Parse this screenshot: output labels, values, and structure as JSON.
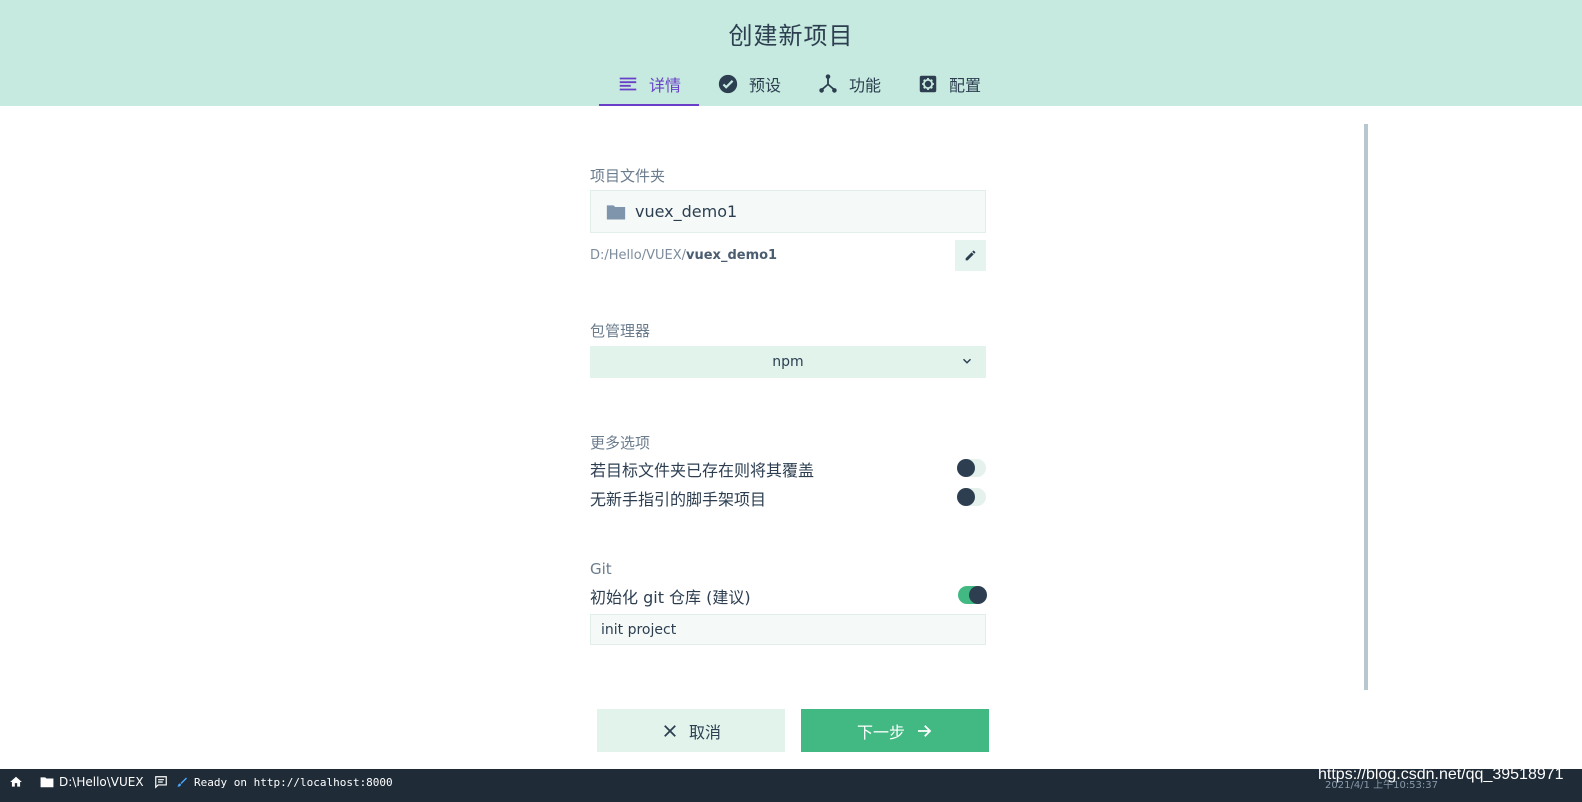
{
  "header": {
    "title": "创建新项目",
    "tabs": [
      {
        "label": "详情",
        "icon": "details-icon",
        "active": true
      },
      {
        "label": "预设",
        "icon": "check-circle-icon",
        "active": false
      },
      {
        "label": "功能",
        "icon": "features-icon",
        "active": false
      },
      {
        "label": "配置",
        "icon": "settings-icon",
        "active": false
      }
    ]
  },
  "form": {
    "folder_label": "项目文件夹",
    "folder_value": "vuex_demo1",
    "path_prefix": "D:/Hello/VUEX/",
    "path_name": "vuex_demo1",
    "package_manager_label": "包管理器",
    "package_manager_value": "npm",
    "more_options_label": "更多选项",
    "options": [
      {
        "label": "若目标文件夹已存在则将其覆盖",
        "on": false
      },
      {
        "label": "无新手指引的脚手架项目",
        "on": false
      }
    ],
    "git_label": "Git",
    "git_init_label": "初始化 git 仓库 (建议)",
    "git_init_on": true,
    "commit_message": "init project"
  },
  "buttons": {
    "cancel": "取消",
    "next": "下一步"
  },
  "statusbar": {
    "cwd": "D:\\Hello\\VUEX",
    "log": "Ready on http://localhost:8000",
    "time": "2021/4/1 上午10:53:37",
    "watermark": "https://blog.csdn.net/qq_39518971"
  },
  "colors": {
    "header_bg": "#c6eadf",
    "accent": "#6a3fc7",
    "primary": "#42b983",
    "dark": "#2c3e50",
    "statusbar_bg": "#1f2b37"
  }
}
